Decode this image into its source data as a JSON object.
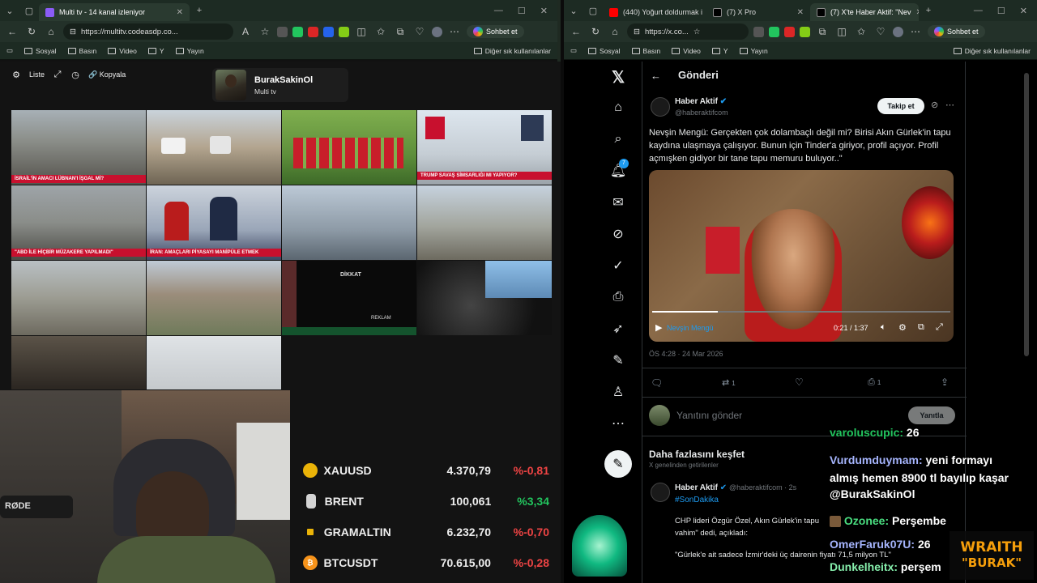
{
  "left_browser": {
    "tabs": [
      {
        "title": "Multi tv - 14 kanal izleniyor",
        "active": true
      }
    ],
    "url": "https://multitv.codeasdp.co...",
    "chat_button": "Sohbet et",
    "bookmarks": [
      "Sosyal",
      "Basın",
      "Video",
      "Y",
      "Yayın"
    ],
    "other_bookmarks": "Diğer sık kullanılanlar"
  },
  "multitv": {
    "controls": {
      "list": "Liste",
      "copy": "Kopyala"
    },
    "profile": {
      "name": "BurakSakinOl",
      "subtitle": "Multi tv"
    },
    "captions": {
      "c1": "İSRAİL'İN AMACI LÜBNAN'I İŞGAL Mİ?",
      "c4": "TRUMP SAVAŞ SİMSARLIĞI MI YAPIYOR?",
      "c5": "\"ABD İLE HİÇBİR MÜZAKERE YAPILMADI\"",
      "c6": "İRAN: AMAÇLARI PİYASAYI MANİPÜLE ETMEK",
      "c11": "DİKKAT",
      "c11b": "REKLAM"
    }
  },
  "tickers": [
    {
      "symbol": "XAUUSD",
      "price": "4.370,79",
      "change": "%-0,81",
      "dir": "neg",
      "coin_color": "#eab308"
    },
    {
      "symbol": "BRENT",
      "price": "100,061",
      "change": "%3,34",
      "dir": "pos",
      "coin_color": "#d4d4d4"
    },
    {
      "symbol": "GRAMALTIN",
      "price": "6.232,70",
      "change": "%-0,70",
      "dir": "neg",
      "coin_color": "#eab308"
    },
    {
      "symbol": "BTCUSDT",
      "price": "70.615,00",
      "change": "%-0,28",
      "dir": "neg",
      "coin_color": "#f7931a"
    }
  ],
  "right_browser": {
    "tabs": [
      {
        "title": "(440) Yoğurt doldurmak i"
      },
      {
        "title": "(7) X Pro"
      },
      {
        "title": "(7) X'te Haber Aktif: \"Nev",
        "active": true
      }
    ],
    "url": "https://x.co...",
    "chat_button": "Sohbet et",
    "bookmarks": [
      "Sosyal",
      "Basın",
      "Video",
      "Y",
      "Yayın"
    ],
    "other_bookmarks": "Diğer sık kullanılanlar"
  },
  "x": {
    "header": "Gönderi",
    "notif_count": "7",
    "post": {
      "author": "Haber Aktif",
      "handle": "@haberaktifcom",
      "follow": "Takip et",
      "text": "Nevşin Mengü: Gerçekten çok dolambaçlı değil mi? Birisi Akın Gürlek'in tapu kaydına ulaşmaya çalışıyor. Bunun için Tinder'a giriyor, profil açıyor. Profil açmışken gidiyor bir tane tapu memuru buluyor..\"",
      "video_label": "Nevşin Mengü",
      "video_time": "0:21 / 1:37",
      "timestamp": "ÖS 4:28 · 24 Mar 2026",
      "retweets": "1",
      "bookmarks": "1"
    },
    "reply_placeholder": "Yanıtını gönder",
    "reply_button": "Yanıtla",
    "discover": {
      "title": "Daha fazlasını keşfet",
      "subtitle": "X genelinden getirilenler"
    },
    "post2": {
      "author": "Haber Aktif",
      "handle": "@haberaktifcom · 2s",
      "hashtag": "#SonDakika",
      "line1": "CHP lideri Özgür Özel, Akın Gürlek'in tapu",
      "line2": "vahim\" dedi, açıkladı:",
      "quote": "\"Gürlek'e ait sadece İzmir'deki üç dairenin fiyatı 71,5 milyon TL\""
    }
  },
  "chat": [
    {
      "user": "varoluscupic:",
      "msg": "26"
    },
    {
      "user": "Vurdumduymam:",
      "msg": "yeni formayı"
    },
    {
      "user": "",
      "msg": "almış hemen 8900 tl bayılıp kaşar"
    },
    {
      "user": "",
      "msg": "@BurakSakinOl"
    },
    {
      "user": "Ozonee:",
      "msg": "Perşembe"
    },
    {
      "user": "OmerFaruk07U:",
      "msg": "26"
    },
    {
      "user": "Dunkelheitx:",
      "msg": "perşem"
    }
  ],
  "sponsor": {
    "line1": "WRAITH",
    "line2": "\"BURAK\""
  },
  "webcam_label": "RØDE"
}
